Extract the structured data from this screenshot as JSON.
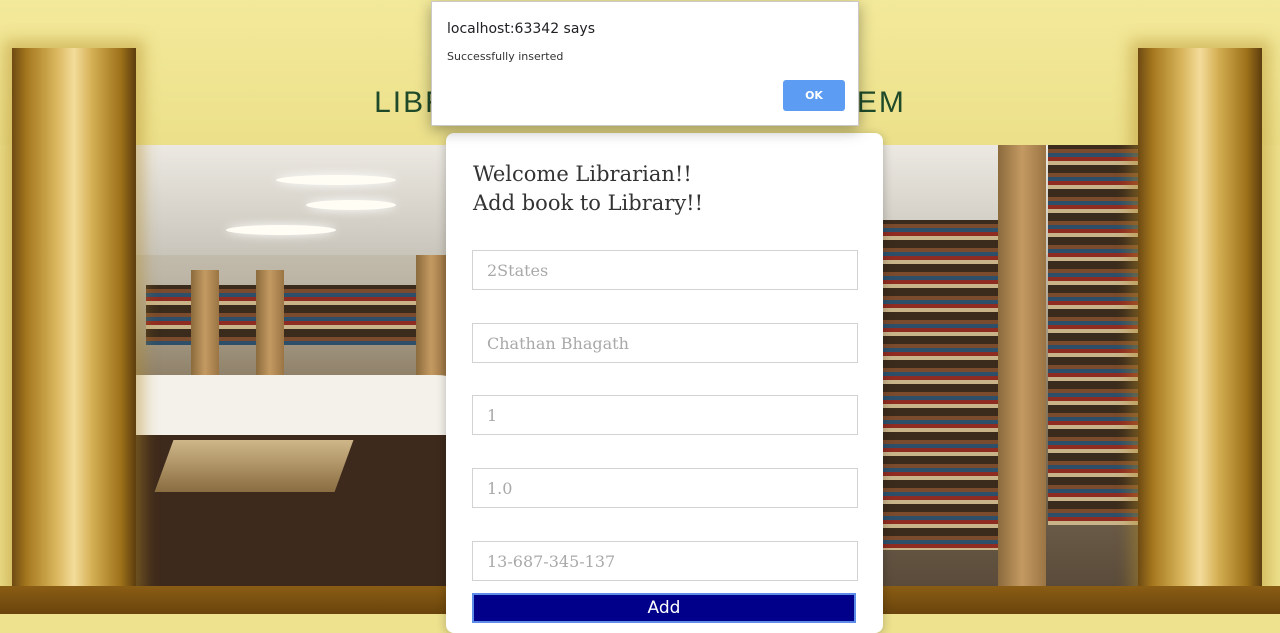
{
  "banner": {
    "title": "LIBRARY MANAGEMENT SYSTEM"
  },
  "alert": {
    "title": "localhost:63342 says",
    "message": "Successfully inserted",
    "ok_label": "OK"
  },
  "form": {
    "heading_line1": "Welcome Librarian!!",
    "heading_line2": "Add book to Library!!",
    "fields": [
      {
        "name": "book-name",
        "value": "",
        "placeholder": "2States"
      },
      {
        "name": "author",
        "value": "",
        "placeholder": "Chathan Bhagath"
      },
      {
        "name": "quantity",
        "value": "",
        "placeholder": "1"
      },
      {
        "name": "version",
        "value": "",
        "placeholder": "1.0"
      },
      {
        "name": "isbn",
        "value": "",
        "placeholder": "13-687-345-137"
      }
    ],
    "add_label": "Add"
  },
  "colors": {
    "banner": "#eee28e",
    "banner_title": "#1f4a2a",
    "add_button": "#00008b",
    "ok_button": "#5c9cf2",
    "pillar_gold": "#d8b45a"
  }
}
